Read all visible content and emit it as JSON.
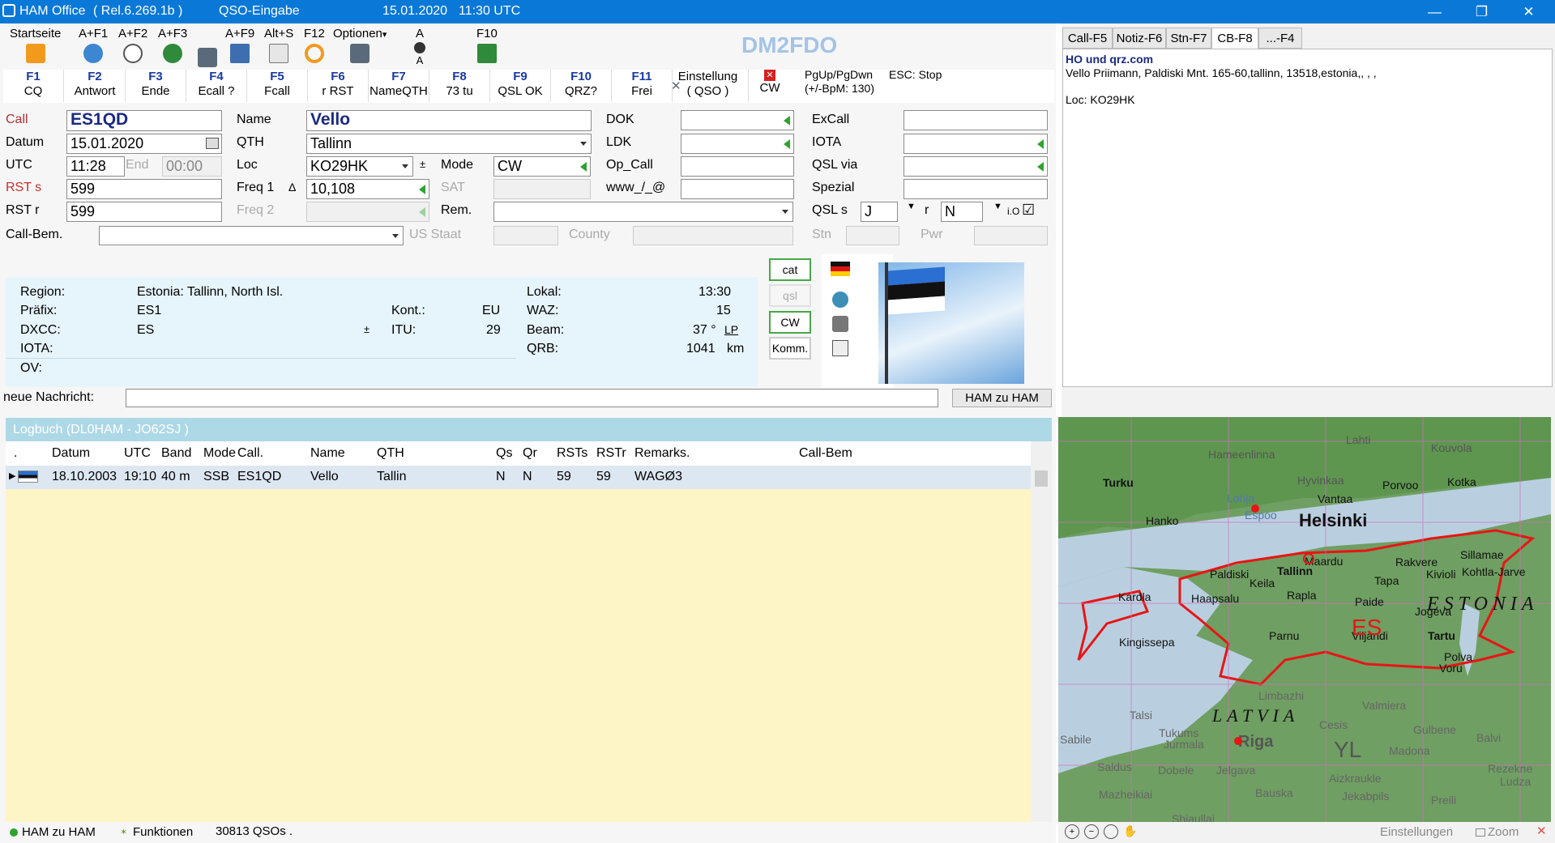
{
  "titlebar": {
    "app": "HAM Office",
    "release": "( Rel.6.269.1b )",
    "mode": "QSO-Eingabe",
    "date": "15.01.2020",
    "time": "11:30 UTC",
    "min": "—",
    "restore": "❐",
    "close": "✕"
  },
  "toolbar": {
    "items": [
      {
        "label": "Startseite",
        "icon": "home-icon",
        "color": "#f29a1e"
      },
      {
        "label": "A+F1",
        "icon": "help-icon",
        "color": "#3c86d2"
      },
      {
        "label": "A+F2",
        "icon": "clock-icon",
        "color": "#7b7b7b"
      },
      {
        "label": "A+F3",
        "icon": "globe-icon",
        "color": "#2f8a3c"
      },
      {
        "label": "",
        "icon": "satellite-icon",
        "color": "#5a6a7a"
      },
      {
        "label": "A+F9",
        "icon": "qsl-card-icon",
        "color": "#3d6fb0"
      },
      {
        "label": "Alt+S",
        "icon": "stats-icon",
        "color": "#7b7b7b"
      },
      {
        "label": "F12",
        "icon": "refresh-icon",
        "color": "#f29a1e"
      },
      {
        "label": "Optionen",
        "icon": "tools-icon",
        "color": "#5a6a7a"
      },
      {
        "label": "A",
        "icon": "antenna-icon",
        "color": "#333333"
      },
      {
        "label": "F10",
        "icon": "save-icon",
        "color": "#2f8a3c"
      }
    ],
    "callsign": "DM2FDO",
    "optionen_arrow": "▾",
    "antenna_sub": "A"
  },
  "fkeys": [
    {
      "key": "F1",
      "label": "CQ"
    },
    {
      "key": "F2",
      "label": "Antwort"
    },
    {
      "key": "F3",
      "label": "Ende"
    },
    {
      "key": "F4",
      "label": "Ecall ?"
    },
    {
      "key": "F5",
      "label": "Fcall"
    },
    {
      "key": "F6",
      "label": "r RST"
    },
    {
      "key": "F7",
      "label": "NameQTH"
    },
    {
      "key": "F8",
      "label": "73 tu"
    },
    {
      "key": "F9",
      "label": "QSL OK"
    },
    {
      "key": "F10",
      "label": "QRZ?"
    },
    {
      "key": "F11",
      "label": "Frei"
    }
  ],
  "fkey_extra": {
    "einstellung": "Einstellung",
    "qso": "( QSO )",
    "cw": "CW",
    "cw_x": "✕",
    "pg": "PgUp/PgDwn",
    "bpm": "(+/-BpM: 130)",
    "esc": "ESC: Stop"
  },
  "form": {
    "call_label": "Call",
    "call": "ES1QD",
    "datum_label": "Datum",
    "datum": "15.01.2020",
    "utc_label": "UTC",
    "utc": "11:28",
    "end_label": "End",
    "end": "00:00",
    "rsts_label": "RST s",
    "rsts": "599",
    "rstr_label": "RST r",
    "rstr": "599",
    "callbem_label": "Call-Bem.",
    "callbem": "",
    "name_label": "Name",
    "name": "Vello",
    "qth_label": "QTH",
    "qth": "Tallinn",
    "loc_label": "Loc",
    "loc": "KO29HK",
    "freq1_label": "Freq 1",
    "freq1": "10,108",
    "delta": "Δ",
    "freq2_label": "Freq 2",
    "freq2": "",
    "mode_label": "Mode",
    "mode": "CW",
    "sat_label": "SAT",
    "sat": "",
    "rem_label": "Rem.",
    "rem": "",
    "dok_label": "DOK",
    "dok": "",
    "ldk_label": "LDK",
    "ldk": "",
    "opcall_label": "Op_Call",
    "opcall": "",
    "www_label": "www_/_@",
    "www": "",
    "excall_label": "ExCall",
    "excall": "",
    "iota_label": "IOTA",
    "iota": "",
    "qslvia_label": "QSL via",
    "qslvia": "",
    "spezial_label": "Spezial",
    "spezial": "",
    "qsls_label": "QSL s",
    "qsls": "J",
    "qslr_label": "r",
    "qslr": "N",
    "io_label": "i.O",
    "io_check": "☑",
    "usstaat_label": "US Staat",
    "usstaat": "",
    "county_label": "County",
    "county": "",
    "stn_label": "Stn",
    "stn": "",
    "pwr_label": "Pwr",
    "pwr": "",
    "sort_mark": "±"
  },
  "info": {
    "region_label": "Region:",
    "region": "Estonia: Tallinn, North Isl.",
    "prefix_label": "Präfix:",
    "prefix": "ES1",
    "dxcc_label": "DXCC:",
    "dxcc": "ES",
    "iota_label": "IOTA:",
    "iota": "",
    "ov_label": "OV:",
    "ov": "",
    "kont_label": "Kont.:",
    "kont": "EU",
    "itu_label": "ITU:",
    "itu": "29",
    "lokal_label": "Lokal:",
    "lokal": "13:30",
    "waz_label": "WAZ:",
    "waz": "15",
    "beam_label": "Beam:",
    "beam": "37 °",
    "lp": "LP",
    "qrb_label": "QRB:",
    "qrb": "1041",
    "qrb_unit": "km",
    "btn_cat": "cat",
    "btn_qsl": "qsl",
    "btn_cw": "CW",
    "btn_komm": "Komm."
  },
  "message": {
    "label": "neue Nachricht:",
    "value": "",
    "button": "HAM zu HAM"
  },
  "logbook": {
    "title": "Logbuch  (DL0HAM - JO62SJ )",
    "columns": [
      ".",
      "Datum",
      "UTC",
      "Band",
      "Mode",
      "Call.",
      "Name",
      "QTH",
      "Qs",
      "Qr",
      "RSTs",
      "RSTr",
      "Remarks.",
      "Call-Bem"
    ],
    "rows": [
      {
        "datum": "18.10.2003",
        "utc": "19:10",
        "band": "40 m",
        "mode": "SSB",
        "call": "ES1QD",
        "name": "Vello",
        "qth": "Tallin",
        "qs": "N",
        "qr": "N",
        "rsts": "59",
        "rstr": "59",
        "remarks": "WAGØ3",
        "callbem": ""
      }
    ]
  },
  "statusbar": {
    "ham": "HAM zu HAM",
    "funktionen": "Funktionen",
    "qsos": "30813 QSOs ."
  },
  "right": {
    "tabs": [
      "Call-F5",
      "Notiz-F6",
      "Stn-F7",
      "CB-F8",
      "...-F4"
    ],
    "info_title": "HO und qrz.com",
    "info_line": "Vello Priimann, Paldiski Mnt. 165-60,tallinn, 13518,estonia,, , ,",
    "info_loc": "Loc:  KO29HK",
    "map_bottom": {
      "einstellungen": "Einstellungen",
      "zoom": "Zoom"
    }
  },
  "map": {
    "country_big": "ESTONIA",
    "prefix_big": "ES",
    "country2": "LATVIA",
    "prefix2": "YL",
    "cities": [
      "Lahti",
      "Kouvola",
      "Hameenlinna",
      "Turku",
      "Hyvinkaa",
      "Porvoo",
      "Kotka",
      "Vantaa",
      "Lohja",
      "Helsinki",
      "Hanko",
      "Espoo",
      "Sillamae",
      "Maardu",
      "Rakvere",
      "Kohtla-Jarve",
      "Paldiski",
      "Tallinn",
      "Keila",
      "Kivioli",
      "Tapa",
      "Kardla",
      "Haapsalu",
      "Rapla",
      "Paide",
      "Jogeva",
      "Kingissepa",
      "Parnu",
      "Viljandi",
      "Tartu",
      "Polva",
      "Voru",
      "Limbazhi",
      "Valmiera",
      "Talsi",
      "Tukums",
      "Jurmala",
      "Cesis",
      "Gulbene",
      "Riga",
      "Madona",
      "Balvi",
      "Sabile",
      "Dobele",
      "Jelgava",
      "Aizkraukle",
      "Rezekne",
      "Saldus",
      "Mazheikiai",
      "Bauska",
      "Jekabpils",
      "Ludza",
      "Preili",
      "Shiaullai"
    ]
  },
  "colors": {
    "titlebar": "#0a78d7",
    "fkey": "#1a3aa0",
    "call_text": "#1a2a80",
    "green": "#2ea32e",
    "logbook_bg": "#fdf5c6",
    "logbook_header": "#e0f0f8",
    "map_land": "#6f9f62",
    "map_sea": "#b9cfe0",
    "border_red": "#e81515"
  }
}
